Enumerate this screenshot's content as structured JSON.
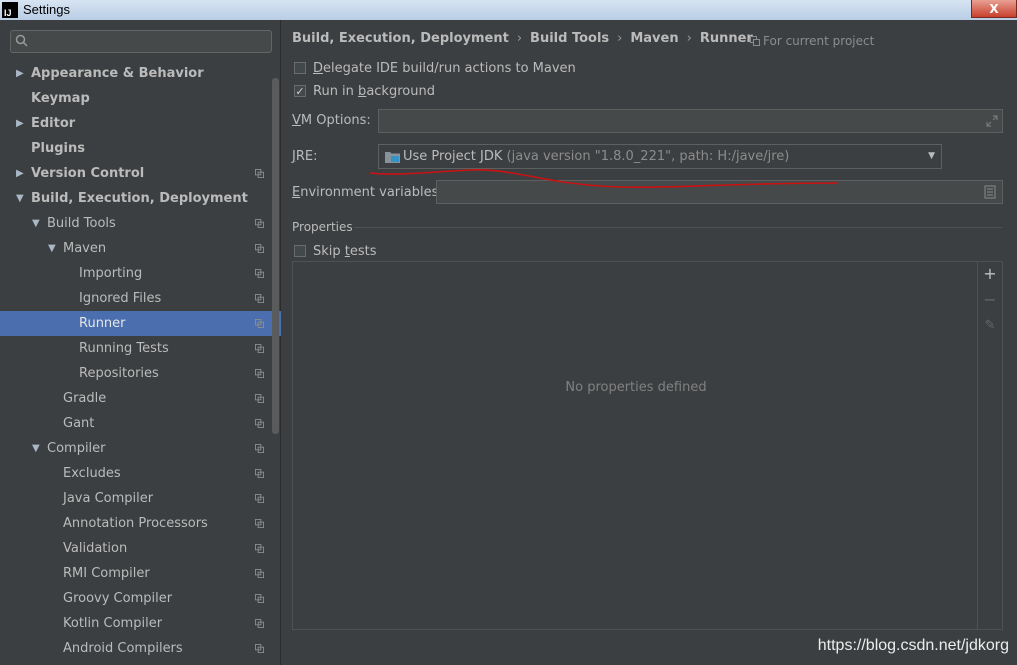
{
  "window": {
    "title": "Settings",
    "app_icon": "IJ",
    "close": "X"
  },
  "sidebar": {
    "search": {
      "value": "",
      "placeholder": ""
    },
    "items": [
      {
        "label": "Appearance & Behavior",
        "level": 0,
        "arrow": "right",
        "bold": true,
        "copy": false
      },
      {
        "label": "Keymap",
        "level": 0,
        "arrow": "none",
        "bold": true,
        "copy": false
      },
      {
        "label": "Editor",
        "level": 0,
        "arrow": "right",
        "bold": true,
        "copy": false
      },
      {
        "label": "Plugins",
        "level": 0,
        "arrow": "none",
        "bold": true,
        "copy": false
      },
      {
        "label": "Version Control",
        "level": 0,
        "arrow": "right",
        "bold": true,
        "copy": true
      },
      {
        "label": "Build, Execution, Deployment",
        "level": 0,
        "arrow": "down",
        "bold": true,
        "copy": false
      },
      {
        "label": "Build Tools",
        "level": 1,
        "arrow": "down",
        "bold": false,
        "copy": true
      },
      {
        "label": "Maven",
        "level": 2,
        "arrow": "down",
        "bold": false,
        "copy": true
      },
      {
        "label": "Importing",
        "level": 3,
        "arrow": "none",
        "bold": false,
        "copy": true
      },
      {
        "label": "Ignored Files",
        "level": 3,
        "arrow": "none",
        "bold": false,
        "copy": true
      },
      {
        "label": "Runner",
        "level": 3,
        "arrow": "none",
        "bold": false,
        "copy": true,
        "selected": true
      },
      {
        "label": "Running Tests",
        "level": 3,
        "arrow": "none",
        "bold": false,
        "copy": true
      },
      {
        "label": "Repositories",
        "level": 3,
        "arrow": "none",
        "bold": false,
        "copy": true
      },
      {
        "label": "Gradle",
        "level": 2,
        "arrow": "none",
        "bold": false,
        "copy": true
      },
      {
        "label": "Gant",
        "level": 2,
        "arrow": "none",
        "bold": false,
        "copy": true
      },
      {
        "label": "Compiler",
        "level": 1,
        "arrow": "down",
        "bold": false,
        "copy": true
      },
      {
        "label": "Excludes",
        "level": 2,
        "arrow": "none",
        "bold": false,
        "copy": true
      },
      {
        "label": "Java Compiler",
        "level": 2,
        "arrow": "none",
        "bold": false,
        "copy": true
      },
      {
        "label": "Annotation Processors",
        "level": 2,
        "arrow": "none",
        "bold": false,
        "copy": true
      },
      {
        "label": "Validation",
        "level": 2,
        "arrow": "none",
        "bold": false,
        "copy": true
      },
      {
        "label": "RMI Compiler",
        "level": 2,
        "arrow": "none",
        "bold": false,
        "copy": true
      },
      {
        "label": "Groovy Compiler",
        "level": 2,
        "arrow": "none",
        "bold": false,
        "copy": true
      },
      {
        "label": "Kotlin Compiler",
        "level": 2,
        "arrow": "none",
        "bold": false,
        "copy": true
      },
      {
        "label": "Android Compilers",
        "level": 2,
        "arrow": "none",
        "bold": false,
        "copy": true
      }
    ]
  },
  "main": {
    "breadcrumb": [
      "Build, Execution, Deployment",
      "Build Tools",
      "Maven",
      "Runner"
    ],
    "breadcrumb_sep": "›",
    "for_current_project": "For current project",
    "delegate": {
      "pre": "",
      "mnemonic": "D",
      "post": "elegate IDE build/run actions to Maven",
      "checked": false
    },
    "run_bg": {
      "pre": "Run in ",
      "mnemonic": "b",
      "post": "ackground",
      "checked": true
    },
    "vm_options": {
      "mnemonic": "V",
      "rest": "M Options:",
      "value": ""
    },
    "jre": {
      "mnemonic": "J",
      "rest": "RE:",
      "value": "Use Project JDK",
      "detail": "(java version \"1.8.0_221\", path: H:/jave/jre)"
    },
    "env": {
      "mnemonic": "E",
      "rest": "nvironment variables:",
      "value": ""
    },
    "properties_title": "Properties",
    "skip_tests": {
      "pre": "Skip ",
      "mnemonic": "t",
      "post": "ests",
      "checked": false
    },
    "empty_text": "No properties defined",
    "toolbar": {
      "add": "+",
      "remove": "−",
      "edit": "✎"
    }
  },
  "watermark": "https://blog.csdn.net/jdkorg",
  "colors": {
    "background": "#3c3f41",
    "selection": "#4b6eaf",
    "annotation": "#cc1111"
  }
}
